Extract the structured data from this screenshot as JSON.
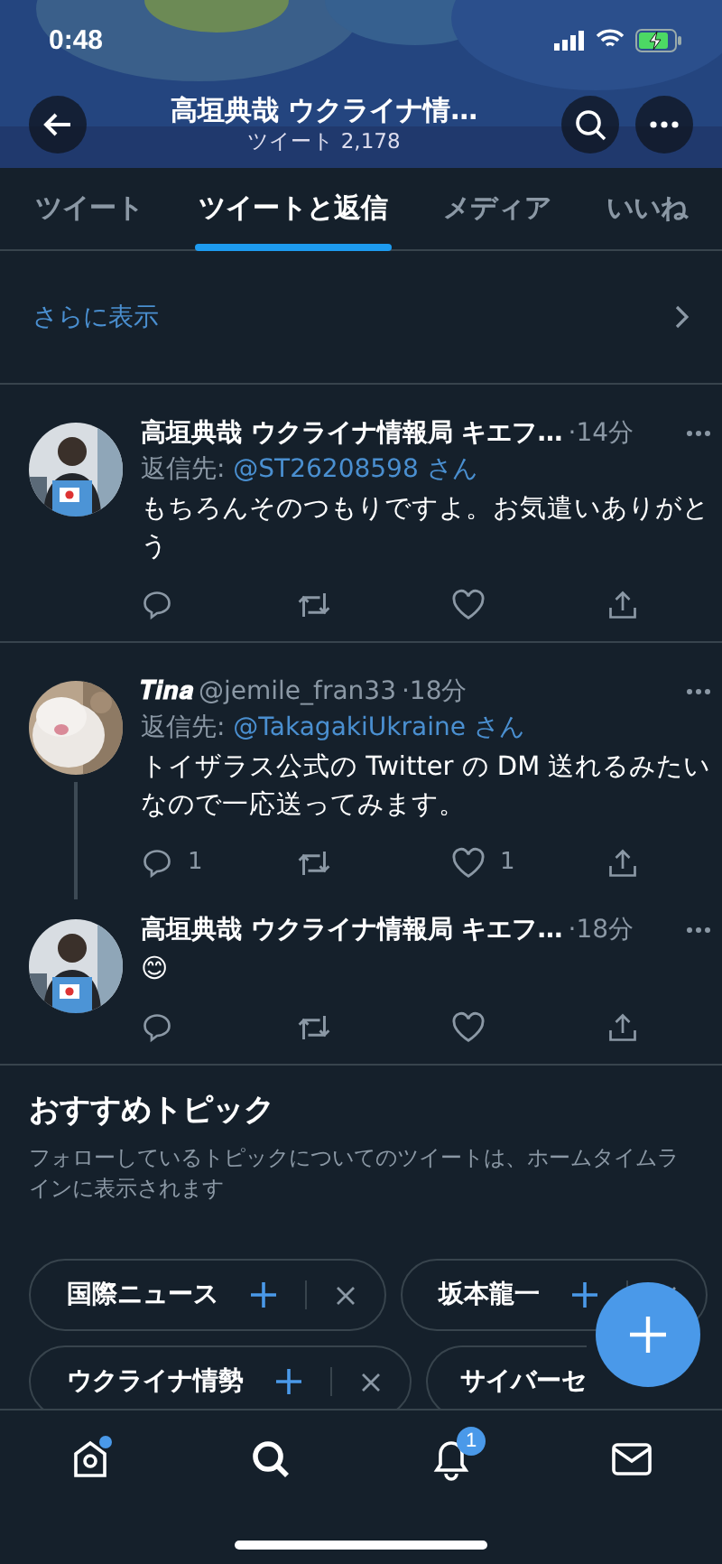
{
  "status_bar": {
    "time": "0:48"
  },
  "header": {
    "title": "高垣典哉 ウクライナ情…",
    "subtitle": "ツイート 2,178"
  },
  "tabs": [
    {
      "label": "ツイート",
      "selected": false
    },
    {
      "label": "ツイートと返信",
      "selected": true
    },
    {
      "label": "メディア",
      "selected": false
    },
    {
      "label": "いいね",
      "selected": false
    }
  ],
  "show_more": {
    "label": "さらに表示"
  },
  "tweets": [
    {
      "author": "高垣典哉 ウクライナ情報局 キエフ…",
      "time": "·14分",
      "reply_prefix": "返信先: ",
      "reply_to": "@ST26208598",
      "reply_suffix": " さん",
      "text": "もちろんそのつもりですよ。お気遣いありがとう",
      "thread_continues": false
    },
    {
      "author": "𝑻𝒊𝒏𝒂",
      "handle": "@jemile_fran33",
      "time": "·18分",
      "reply_prefix": "返信先: ",
      "reply_to": "@TakagakiUkraine",
      "reply_suffix": " さん",
      "text": "トイザラス公式の Twitter の DM 送れるみたいなので一応送ってみます。",
      "thread_continues": true,
      "replies": "1",
      "likes": "1"
    },
    {
      "author": "高垣典哉 ウクライナ情報局 キエフ…",
      "time": "·18分",
      "text": "😊",
      "thread_continues": false
    }
  ],
  "topics": {
    "title": "おすすめトピック",
    "description": "フォローしているトピックについてのツイートは、ホームタイムラインに表示されます",
    "rows": [
      [
        {
          "label": "国際ニュース"
        },
        {
          "label": "坂本龍一"
        }
      ],
      [
        {
          "label": "ウクライナ情勢"
        },
        {
          "label": "サイバーセ"
        }
      ]
    ]
  },
  "bottom_nav": [
    {
      "kind": "home",
      "dot": true
    },
    {
      "kind": "search",
      "dot": false
    },
    {
      "kind": "bell",
      "dot": false,
      "badge": "1"
    },
    {
      "kind": "mail",
      "dot": false
    }
  ]
}
